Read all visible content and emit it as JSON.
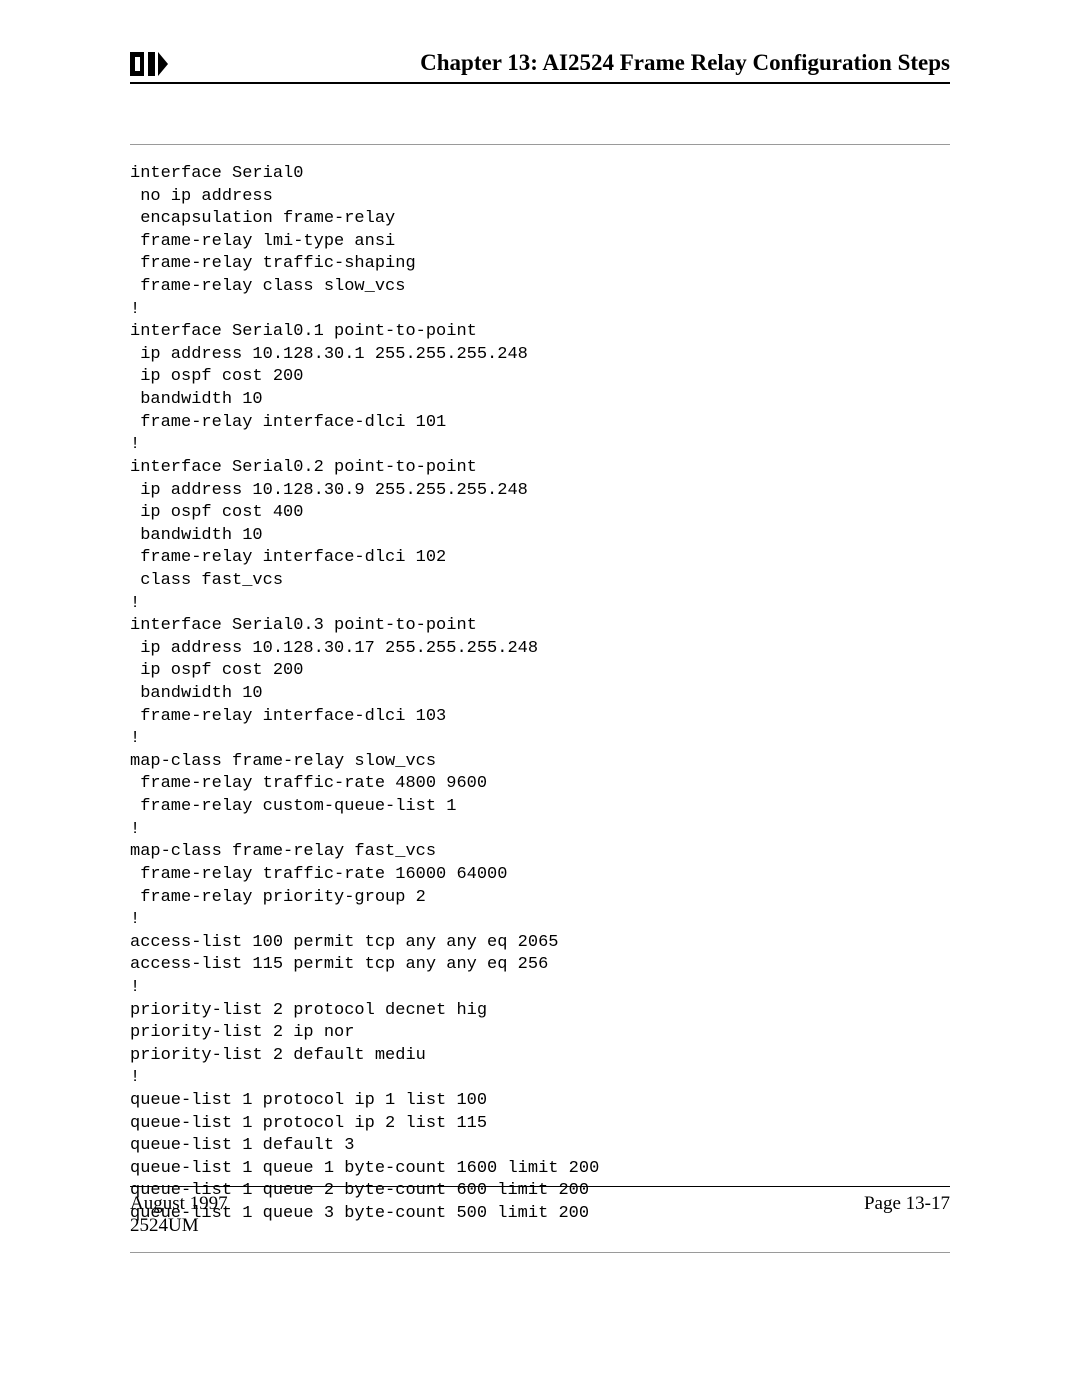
{
  "header": {
    "chapter_title": "Chapter 13: AI2524 Frame Relay Configuration Steps"
  },
  "code": "interface Serial0\n no ip address\n encapsulation frame-relay\n frame-relay lmi-type ansi\n frame-relay traffic-shaping\n frame-relay class slow_vcs\n!\ninterface Serial0.1 point-to-point\n ip address 10.128.30.1 255.255.255.248\n ip ospf cost 200\n bandwidth 10\n frame-relay interface-dlci 101\n!\ninterface Serial0.2 point-to-point\n ip address 10.128.30.9 255.255.255.248\n ip ospf cost 400\n bandwidth 10\n frame-relay interface-dlci 102\n class fast_vcs\n!\ninterface Serial0.3 point-to-point\n ip address 10.128.30.17 255.255.255.248\n ip ospf cost 200\n bandwidth 10\n frame-relay interface-dlci 103\n!\nmap-class frame-relay slow_vcs\n frame-relay traffic-rate 4800 9600\n frame-relay custom-queue-list 1\n!\nmap-class frame-relay fast_vcs\n frame-relay traffic-rate 16000 64000\n frame-relay priority-group 2\n!\naccess-list 100 permit tcp any any eq 2065\naccess-list 115 permit tcp any any eq 256\n!\npriority-list 2 protocol decnet hig\npriority-list 2 ip nor\npriority-list 2 default mediu\n!\nqueue-list 1 protocol ip 1 list 100\nqueue-list 1 protocol ip 2 list 115\nqueue-list 1 default 3\nqueue-list 1 queue 1 byte-count 1600 limit 200\nqueue-list 1 queue 2 byte-count 600 limit 200\nqueue-list 1 queue 3 byte-count 500 limit 200",
  "footer": {
    "date": "August 1997",
    "docnum": "2524UM",
    "page": "Page 13-17"
  }
}
